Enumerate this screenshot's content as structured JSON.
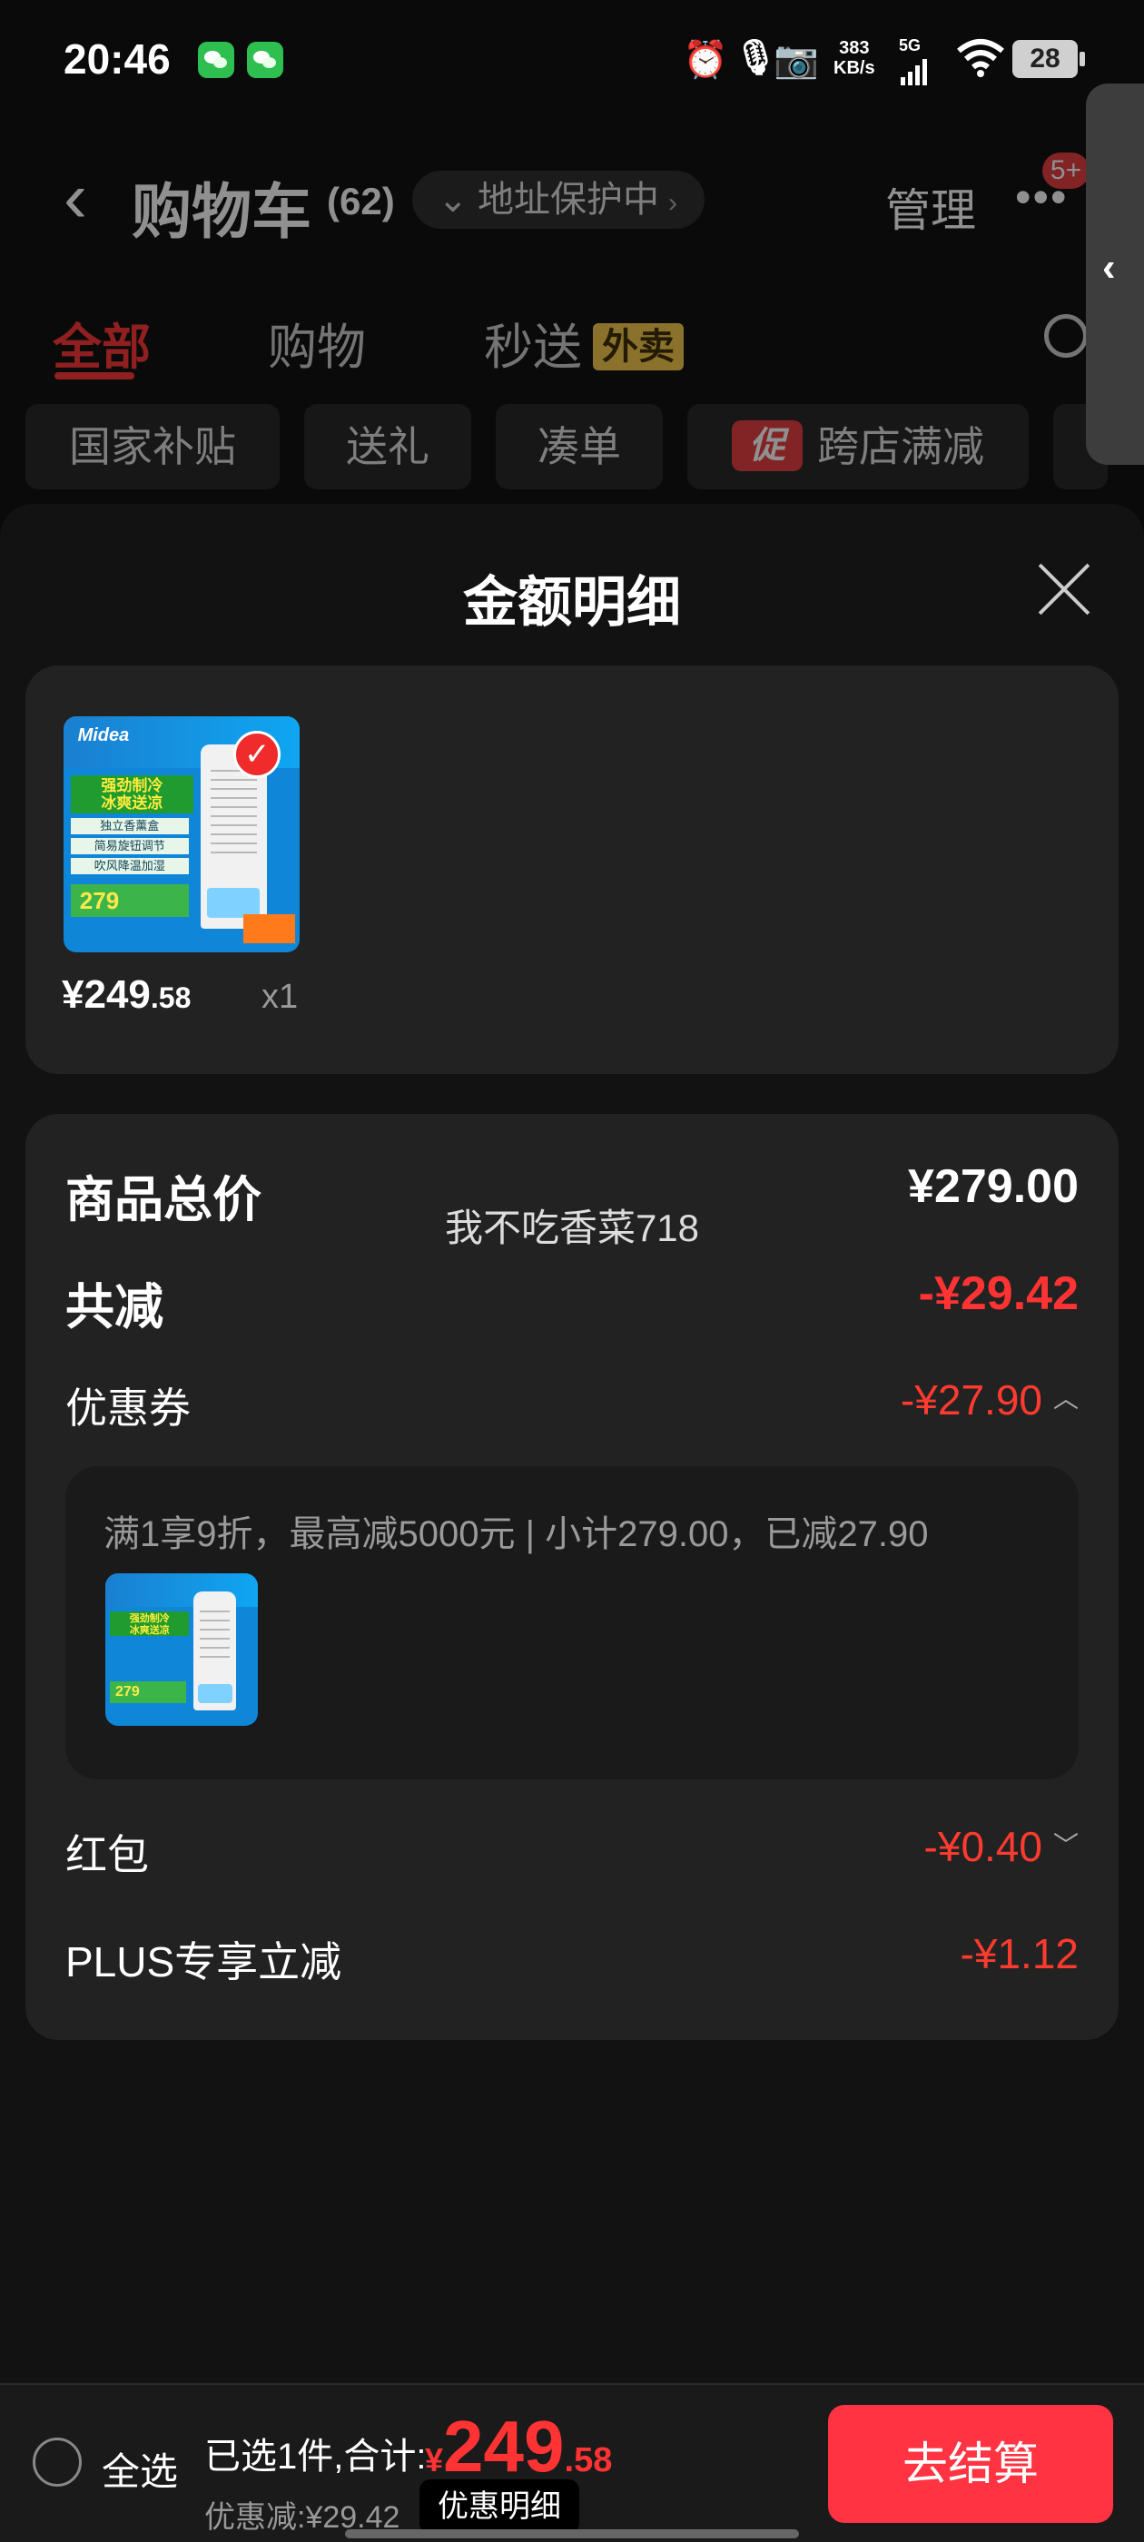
{
  "status_bar": {
    "time": "20:46",
    "net_speed_value": "383",
    "net_speed_unit": "KB/s",
    "network_type": "5G",
    "battery": "28"
  },
  "header": {
    "title": "购物车",
    "count": "(62)",
    "address_protect": "地址保护中",
    "manage": "管理",
    "more_badge": "5+"
  },
  "tabs": [
    {
      "label": "全部",
      "active": true
    },
    {
      "label": "购物"
    },
    {
      "label": "秒送",
      "tag": "外卖"
    }
  ],
  "chips": [
    "国家补贴",
    "送礼",
    "凑单",
    "跨店满减"
  ],
  "promo_badge": "促",
  "sheet": {
    "title": "金额明细",
    "product": {
      "price_int": "¥249",
      "price_dec": ".58",
      "qty": "x1",
      "image_brand": "Midea",
      "image_slogan_1": "强劲制冷",
      "image_slogan_2": "冰爽送凉",
      "image_rows": [
        "独立香薰盒",
        "简易旋钮调节",
        "吹风降温加湿"
      ],
      "image_price": "279"
    },
    "detail": {
      "total_label": "商品总价",
      "total_value": "¥279.00",
      "watermark": "我不吃香菜718",
      "reduce_label": "共减",
      "reduce_value": "-¥29.42",
      "coupon_label": "优惠券",
      "coupon_value": "-¥27.90",
      "coupon_desc": "满1享9折，最高减5000元 | 小计279.00，已减27.90",
      "redpack_label": "红包",
      "redpack_value": "-¥0.40",
      "plus_label": "PLUS专享立减",
      "plus_value": "-¥1.12"
    }
  },
  "bottom_bar": {
    "select_all": "全选",
    "selected_summary": "已选1件,合计:",
    "total_currency": "¥",
    "total_int": "249",
    "total_dec": ".58",
    "discount": "优惠减:¥29.42",
    "detail_button": "优惠明细",
    "checkout_button": "去结算"
  },
  "colors": {
    "accent_red": "#ff3333",
    "background": "#0a0a0a",
    "card": "#222222"
  }
}
